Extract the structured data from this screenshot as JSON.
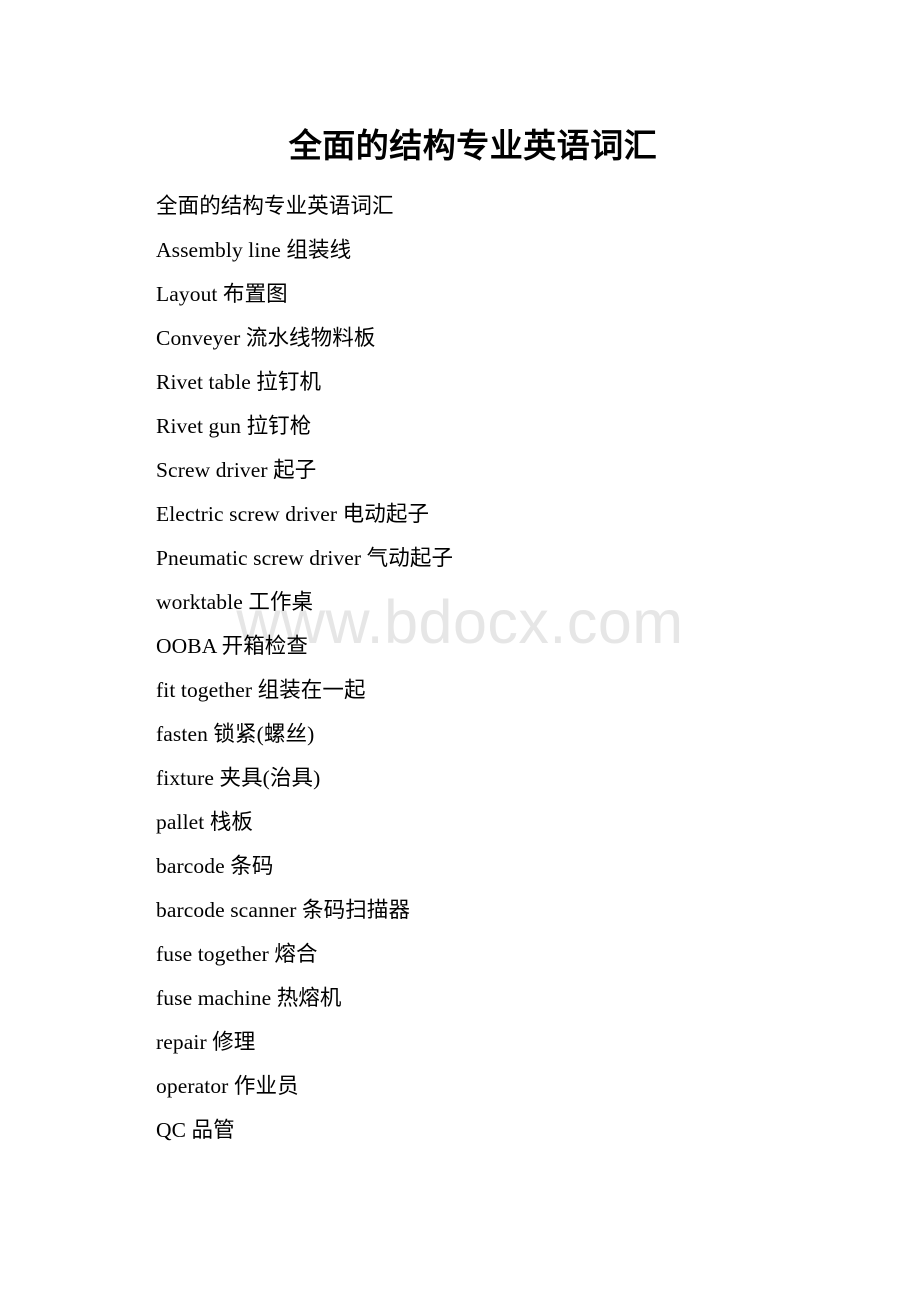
{
  "document": {
    "title": "全面的结构专业英语词汇",
    "watermark": "www.bdocx.com",
    "paragraphs": [
      "全面的结构专业英语词汇",
      "Assembly line 组装线",
      "Layout 布置图",
      "Conveyer 流水线物料板",
      "Rivet table 拉钉机",
      "Rivet gun 拉钉枪",
      "Screw driver 起子",
      "Electric screw driver 电动起子",
      "Pneumatic screw driver 气动起子",
      "worktable 工作桌",
      "OOBA 开箱检查",
      "fit together 组装在一起",
      "fasten 锁紧(螺丝)",
      "fixture 夹具(治具)",
      "pallet 栈板",
      "barcode 条码",
      "barcode scanner 条码扫描器",
      "fuse together 熔合",
      "fuse machine 热熔机",
      "repair 修理",
      "operator 作业员",
      "QC 品管"
    ]
  },
  "colors": {
    "page_background": "#ffffff",
    "text": "#000000",
    "watermark": "#e6e6e6"
  }
}
